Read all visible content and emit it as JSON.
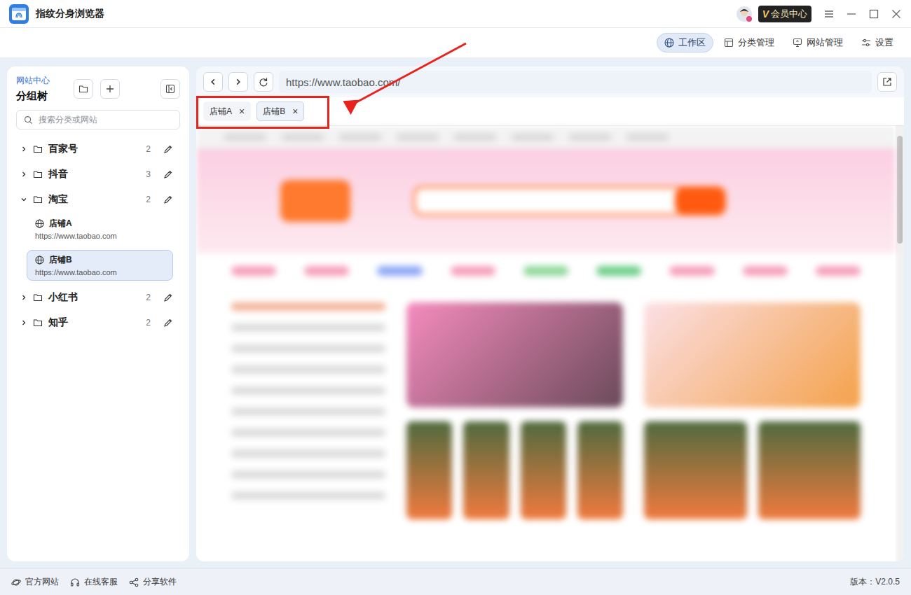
{
  "window": {
    "title": "指纹分身浏览器"
  },
  "title_bar": {
    "vip_mark": "V",
    "vip_label": "会员中心"
  },
  "nav": [
    {
      "label": "工作区",
      "selected": true
    },
    {
      "label": "分类管理",
      "selected": false
    },
    {
      "label": "网站管理",
      "selected": false
    },
    {
      "label": "设置",
      "selected": false
    }
  ],
  "sidebar": {
    "caption": "网站中心",
    "title": "分组树",
    "search_placeholder": "搜索分类或网站",
    "groups": [
      {
        "name": "百家号",
        "count": "2",
        "expanded": false,
        "sites": []
      },
      {
        "name": "抖音",
        "count": "3",
        "expanded": false,
        "sites": []
      },
      {
        "name": "淘宝",
        "count": "2",
        "expanded": true,
        "sites": [
          {
            "name": "店铺A",
            "url": "https://www.taobao.com",
            "selected": false
          },
          {
            "name": "店铺B",
            "url": "https://www.taobao.com",
            "selected": true
          }
        ]
      },
      {
        "name": "小红书",
        "count": "2",
        "expanded": false,
        "sites": []
      },
      {
        "name": "知乎",
        "count": "2",
        "expanded": false,
        "sites": []
      }
    ]
  },
  "browser": {
    "url": "https://www.taobao.com/",
    "tab_close": "×",
    "tabs": [
      {
        "label": "店铺A",
        "selected": false
      },
      {
        "label": "店铺B",
        "selected": true
      }
    ],
    "scrollbar": {
      "level": 0.26
    }
  },
  "footer": {
    "links": [
      "官方网站",
      "在线客服",
      "分享软件"
    ],
    "version": "版本：V2.0.5"
  }
}
